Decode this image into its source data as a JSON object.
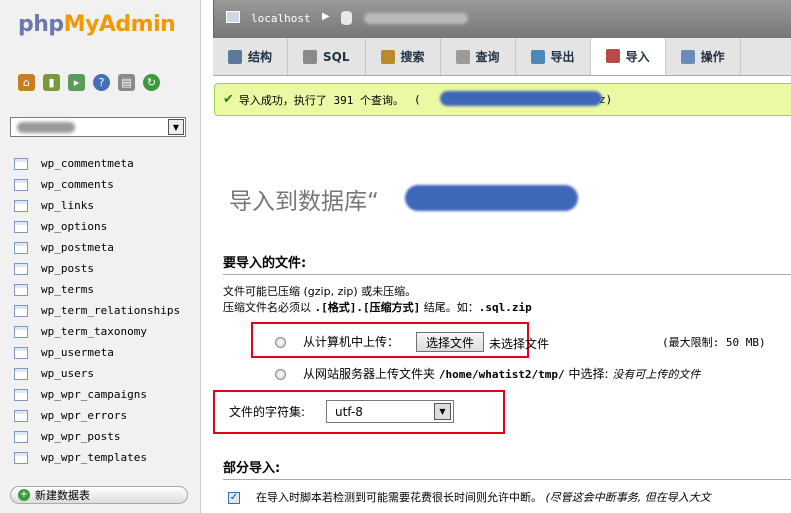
{
  "logo": {
    "php": "php",
    "my": "My",
    "admin": "Admin"
  },
  "quick_icons": [
    "home-icon",
    "exit-icon",
    "sql-query-icon",
    "help-icon",
    "docs-icon",
    "reload-icon"
  ],
  "sidebar": {
    "tables": [
      "wp_commentmeta",
      "wp_comments",
      "wp_links",
      "wp_options",
      "wp_postmeta",
      "wp_posts",
      "wp_terms",
      "wp_term_relationships",
      "wp_term_taxonomy",
      "wp_usermeta",
      "wp_users",
      "wp_wpr_campaigns",
      "wp_wpr_errors",
      "wp_wpr_posts",
      "wp_wpr_templates"
    ],
    "new_table": "新建数据表"
  },
  "breadcrumb": {
    "server": "localhost"
  },
  "tabs": [
    {
      "label": "结构",
      "icon": "structure-icon"
    },
    {
      "label": "SQL",
      "icon": "sql-icon"
    },
    {
      "label": "搜索",
      "icon": "search-icon"
    },
    {
      "label": "查询",
      "icon": "query-icon"
    },
    {
      "label": "导出",
      "icon": "export-icon"
    },
    {
      "label": "导入",
      "icon": "import-icon",
      "active": true
    },
    {
      "label": "操作",
      "icon": "operations-icon"
    }
  ],
  "success": {
    "message": "导入成功，执行了 391 个查询。",
    "paren_open": "(",
    "tail": "z)"
  },
  "heading": {
    "prefix": "导入到数据库“",
    "suffix": "”"
  },
  "file_section": {
    "title": "要导入的文件:",
    "line1": "文件可能已压缩 (gzip, zip) 或未压缩。",
    "line2_prefix": "压缩文件名必须以 ",
    "line2_format": ".[格式].[压缩方式]",
    "line2_mid": " 结尾。如：",
    "line2_example": ".sql.zip",
    "upload_label": "从计算机中上传：",
    "choose_file": "选择文件",
    "no_file": "未选择文件",
    "limit": "(最大限制: 50 MB)",
    "server_label": "从网站服务器上传文件夹",
    "server_path": "/home/whatist2/tmp/",
    "server_mid": "中选择:",
    "server_none": "没有可上传的文件",
    "charset_label": "文件的字符集:",
    "charset_value": "utf-8"
  },
  "partial_section": {
    "title": "部分导入:",
    "allow_interrupt": "在导入时脚本若检测到可能需要花费很长时间则允许中断。",
    "allow_interrupt_note": "(尽管这会中断事务, 但在导入大文"
  },
  "colors": {
    "accent_orange": "#f29900",
    "php_blue": "#6c78af",
    "success_bg": "#ebf8a4",
    "highlight_red": "#e2001a"
  }
}
